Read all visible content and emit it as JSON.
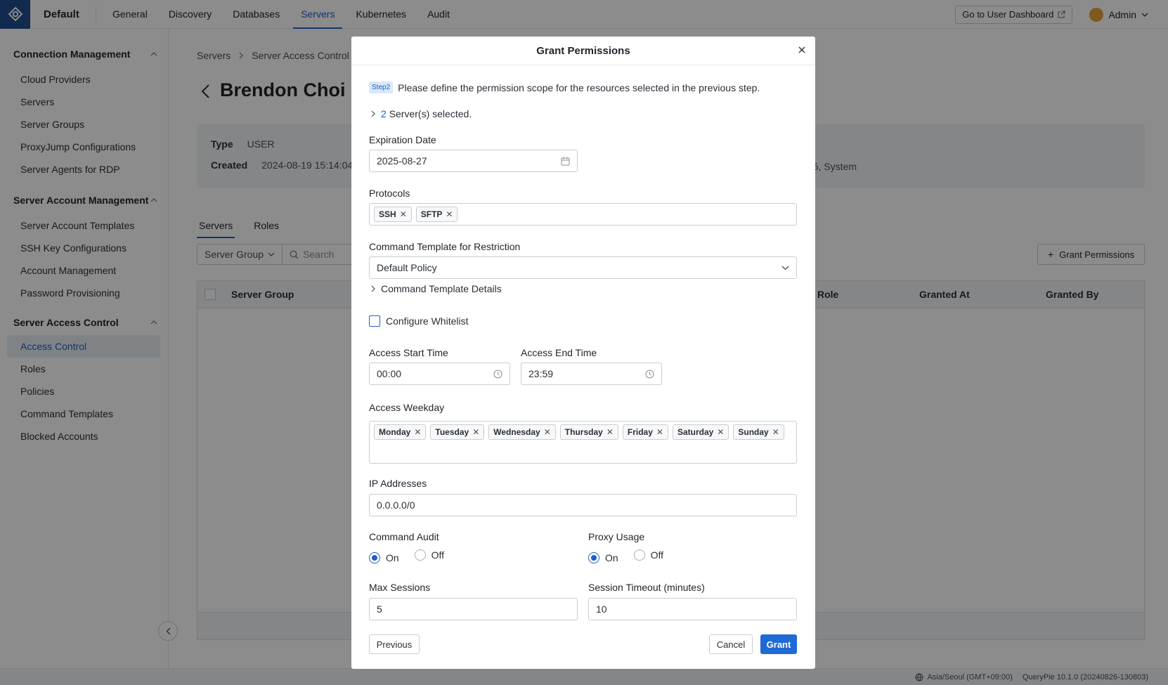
{
  "topbar": {
    "workspace": "Default",
    "nav": [
      "General",
      "Discovery",
      "Databases",
      "Servers",
      "Kubernetes",
      "Audit"
    ],
    "active_nav": "Servers",
    "dashboard_button": "Go to User Dashboard",
    "user": "Admin"
  },
  "sidebar": {
    "sections": [
      {
        "title": "Connection Management",
        "items": [
          "Cloud Providers",
          "Servers",
          "Server Groups",
          "ProxyJump Configurations",
          "Server Agents for RDP"
        ]
      },
      {
        "title": "Server Account Management",
        "items": [
          "Server Account Templates",
          "SSH Key Configurations",
          "Account Management",
          "Password Provisioning"
        ]
      },
      {
        "title": "Server Access Control",
        "items": [
          "Access Control",
          "Roles",
          "Policies",
          "Command Templates",
          "Blocked Accounts"
        ]
      }
    ],
    "active_item": "Access Control"
  },
  "main": {
    "breadcrumb": [
      "Servers",
      "Server Access Control"
    ],
    "title": "Brendon Choi",
    "info": {
      "type_label": "Type",
      "type_value": "USER",
      "created_label": "Created",
      "created_value": "2024-08-19 15:14:04,",
      "right_value": "5, System"
    },
    "tabs": [
      "Servers",
      "Roles"
    ],
    "filter_select": "Server Group",
    "search_placeholder": "Search",
    "grant_button": "Grant Permissions",
    "columns": [
      "Server Group",
      "Role",
      "Granted At",
      "Granted By"
    ]
  },
  "statusbar": {
    "timezone": "Asia/Seoul (GMT+09:00)",
    "version": "QueryPie 10.1.0 (20240826-130803)"
  },
  "modal": {
    "title": "Grant Permissions",
    "step": "Step2",
    "description": "Please define the permission scope for the resources selected in the previous step.",
    "selected_count": "2",
    "selected_text": "Server(s) selected.",
    "expiration_label": "Expiration Date",
    "expiration_value": "2025-08-27",
    "protocols_label": "Protocols",
    "protocols": [
      "SSH",
      "SFTP"
    ],
    "command_template_label": "Command Template for Restriction",
    "command_template_value": "Default Policy",
    "command_template_details": "Command Template Details",
    "whitelist_label": "Configure Whitelist",
    "access_start_label": "Access Start Time",
    "access_start_value": "00:00",
    "access_end_label": "Access End Time",
    "access_end_value": "23:59",
    "weekday_label": "Access Weekday",
    "weekdays": [
      "Monday",
      "Tuesday",
      "Wednesday",
      "Thursday",
      "Friday",
      "Saturday",
      "Sunday"
    ],
    "ip_label": "IP Addresses",
    "ip_value": "0.0.0.0/0",
    "command_audit_label": "Command Audit",
    "proxy_usage_label": "Proxy Usage",
    "on_label": "On",
    "off_label": "Off",
    "max_sessions_label": "Max Sessions",
    "max_sessions_value": "5",
    "session_timeout_label": "Session Timeout (minutes)",
    "session_timeout_value": "10",
    "previous_button": "Previous",
    "cancel_button": "Cancel",
    "grant_button": "Grant"
  }
}
